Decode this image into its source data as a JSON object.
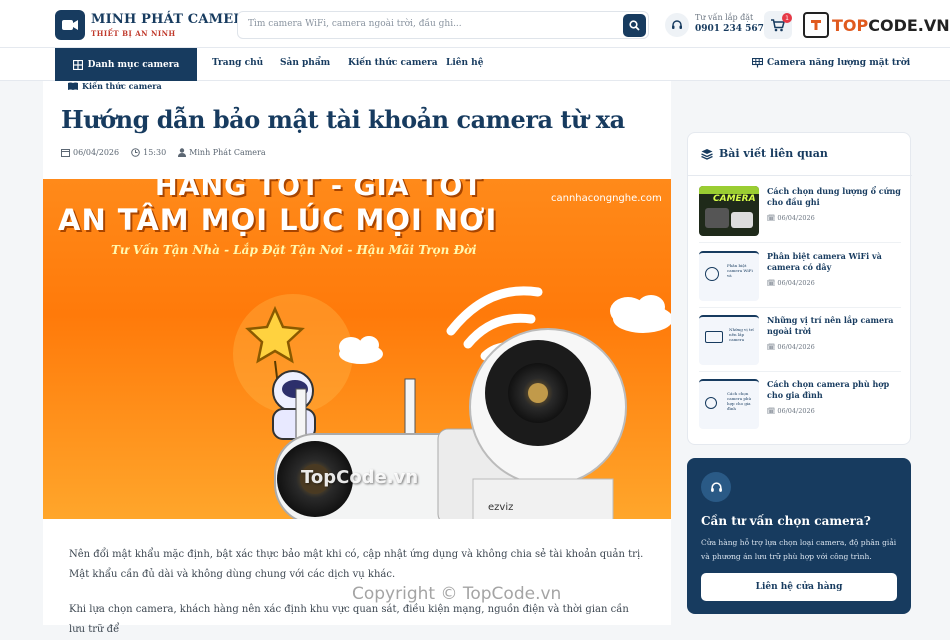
{
  "header": {
    "brand": "MINH PHÁT CAMERA",
    "slogan": "THIẾT BỊ AN NINH",
    "search_placeholder": "Tìm camera WiFi, camera ngoài trời, đầu ghi...",
    "hotline_label": "Tư vấn lắp đặt",
    "hotline_number": "0901 234 567",
    "cart_count": "1",
    "watermark_prefix": "TOP",
    "watermark_suffix": "CODE.VN"
  },
  "nav": {
    "category_label": "Danh mục camera",
    "items": [
      "Trang chủ",
      "Sản phẩm",
      "Kiến thức camera",
      "Liên hệ"
    ],
    "right_label": "Camera năng lượng mặt trời"
  },
  "article": {
    "breadcrumb": "Kiến thức camera",
    "title": "Hướng dẫn bảo mật tài khoản camera từ xa",
    "date": "06/04/2026",
    "time": "15:30",
    "author": "Minh Phát Camera",
    "hero": {
      "line1": "HÀNG TỐT - GIÁ TỐT",
      "line2": "AN TÂM MỌI LÚC MỌI NƠI",
      "tagline": "Tư Vấn Tận Nhà - Lắp Đặt Tận Nơi - Hậu Mãi Trọn Đời",
      "site": "cannhacongnghe.com",
      "brand_label": "ezviz",
      "watermark": "TopCode.vn"
    },
    "paragraphs": [
      "Nên đổi mật khẩu mặc định, bật xác thực bảo mật khi có, cập nhật ứng dụng và không chia sẻ tài khoản quản trị. Mật khẩu cần đủ dài và không dùng chung với các dịch vụ khác.",
      "Khi lựa chọn camera, khách hàng nên xác định khu vực quan sát, điều kiện mạng, nguồn điện và thời gian cần lưu trữ để"
    ]
  },
  "related": {
    "heading": "Bài viết liên quan",
    "items": [
      {
        "title": "Cách chọn dung lượng ổ cứng cho đầu ghi",
        "date": "06/04/2026",
        "thumb_text": "CAMERA"
      },
      {
        "title": "Phân biệt camera WiFi và camera có dây",
        "date": "06/04/2026",
        "thumb_text": "Phân biệt camera WiFi và"
      },
      {
        "title": "Những vị trí nên lắp camera ngoài trời",
        "date": "06/04/2026",
        "thumb_text": "Những vị trí nên lắp camera"
      },
      {
        "title": "Cách chọn camera phù hợp cho gia đình",
        "date": "06/04/2026",
        "thumb_text": "Cách chọn camera phù hợp cho gia đình"
      }
    ]
  },
  "advice": {
    "title": "Cần tư vấn chọn camera?",
    "description": "Cửa hàng hỗ trợ lựa chọn loại camera, độ phân giải và phương án lưu trữ phù hợp với công trình.",
    "button": "Liên hệ cửa hàng"
  },
  "footer_watermark": "Copyright © TopCode.vn",
  "colors": {
    "primary": "#173b5f",
    "accent": "#e63946",
    "hero_orange": "#ff7a0a"
  }
}
